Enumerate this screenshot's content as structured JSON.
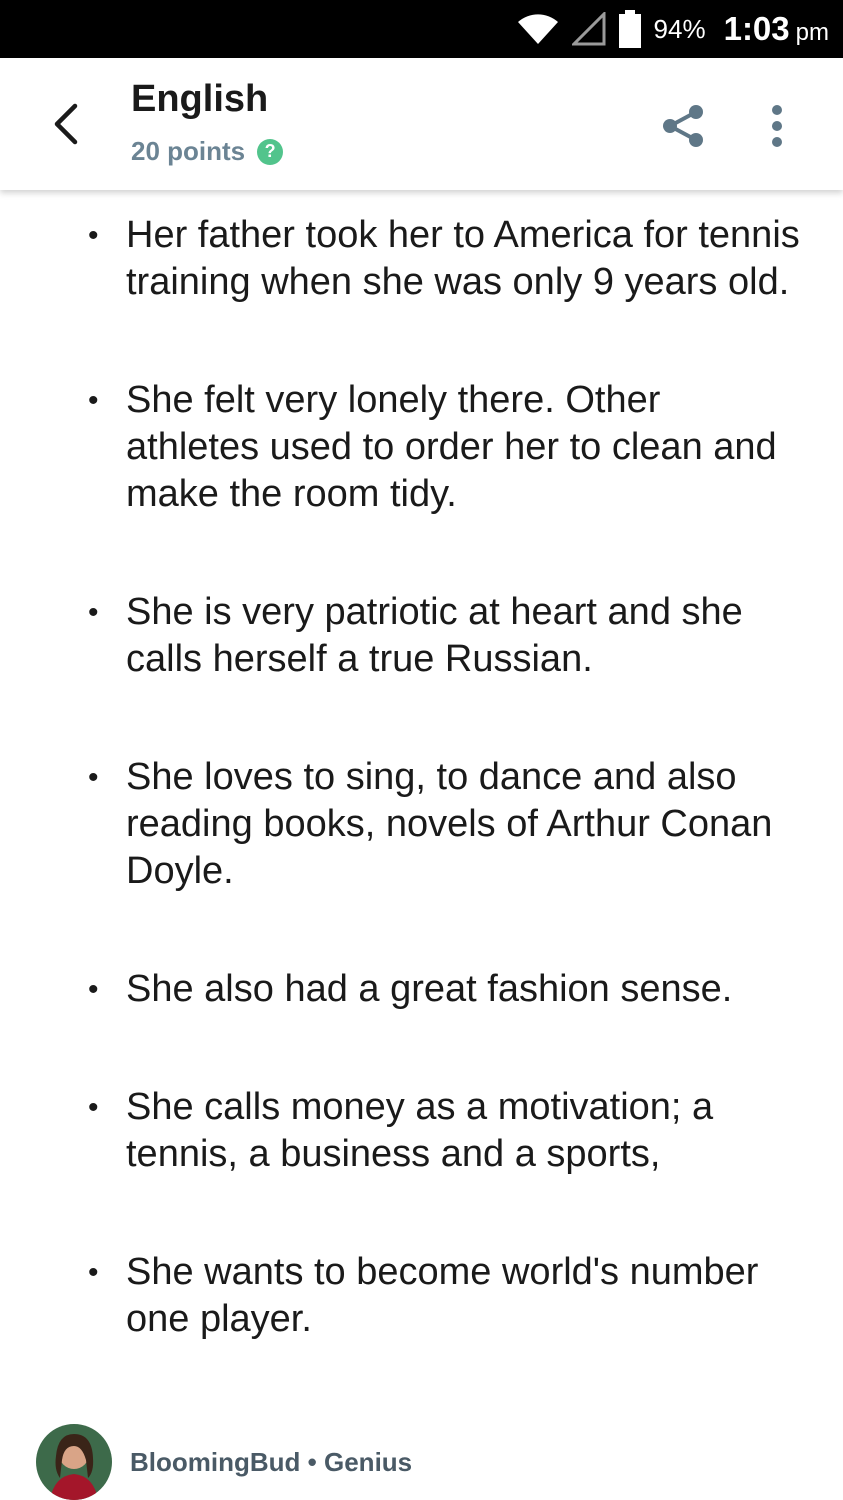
{
  "status_bar": {
    "battery_percent": "94%",
    "time": "1:03",
    "ampm": "pm"
  },
  "header": {
    "title": "English",
    "points": "20 points",
    "help_glyph": "?"
  },
  "answer": {
    "bullets": [
      "Her father took her to America for tennis training when she was only 9 years old.",
      "She felt very lonely there. Other athletes used to order her to clean and make the room tidy.",
      "She is very patriotic at heart and she calls herself a true Russian.",
      "She loves to sing, to dance and also reading books, novels of Arthur Conan Doyle.",
      "She also had a great fashion sense.",
      "She calls money as a motivation; a tennis, a business and a sports,",
      "She wants to become world's number one player."
    ]
  },
  "author": {
    "name": "BloomingBud",
    "separator": "•",
    "rank": "Genius"
  },
  "colors": {
    "status_bar_bg": "#000000",
    "accent_green": "#52c48c",
    "muted_text": "#6b8494",
    "author_text": "#4a5a66"
  },
  "icons": [
    "wifi-icon",
    "cell-signal-icon",
    "battery-icon",
    "back-arrow-icon",
    "share-icon",
    "more-vert-icon",
    "help-icon"
  ]
}
